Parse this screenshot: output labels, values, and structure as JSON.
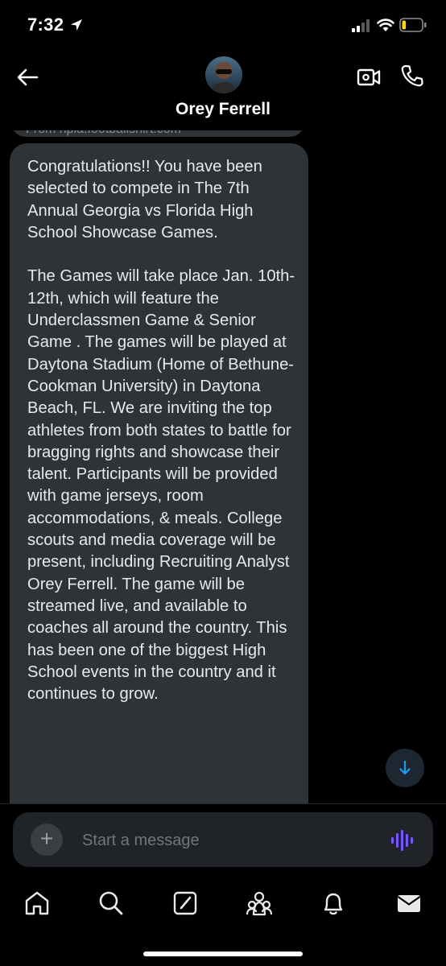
{
  "status_bar": {
    "time": "7:32",
    "battery_level": 0.2
  },
  "header": {
    "contact_name": "Orey Ferrell"
  },
  "conversation": {
    "previous_message_text": "From hpia.footballshirt.com",
    "message": "Congratulations!! You have been selected to compete in The 7th Annual Georgia vs Florida High School Showcase Games.\n\nThe Games will take place Jan. 10th-12th, which will feature the Underclassmen Game & Senior Game . The games will be played at Daytona Stadium (Home of Bethune-Cookman University) in Daytona Beach, FL. We are inviting the top athletes from both states to battle for bragging rights and showcase their talent. Participants will be provided with game jerseys, room accommodations, & meals. College scouts and media coverage will be present, including Recruiting Analyst Orey Ferrell. The game will be streamed live, and available to coaches all around the country. This has been one of the biggest High School events in the country and it continues to grow."
  },
  "composer": {
    "placeholder": "Start a message"
  },
  "tabs": [
    "home-icon",
    "search-icon",
    "compose-icon",
    "communities-icon",
    "notifications-icon",
    "messages-icon"
  ],
  "colors": {
    "accent": "#1d9bf0",
    "voice": "#7856ff",
    "bubble": "#2f3336",
    "battery": "#ffd60a"
  }
}
